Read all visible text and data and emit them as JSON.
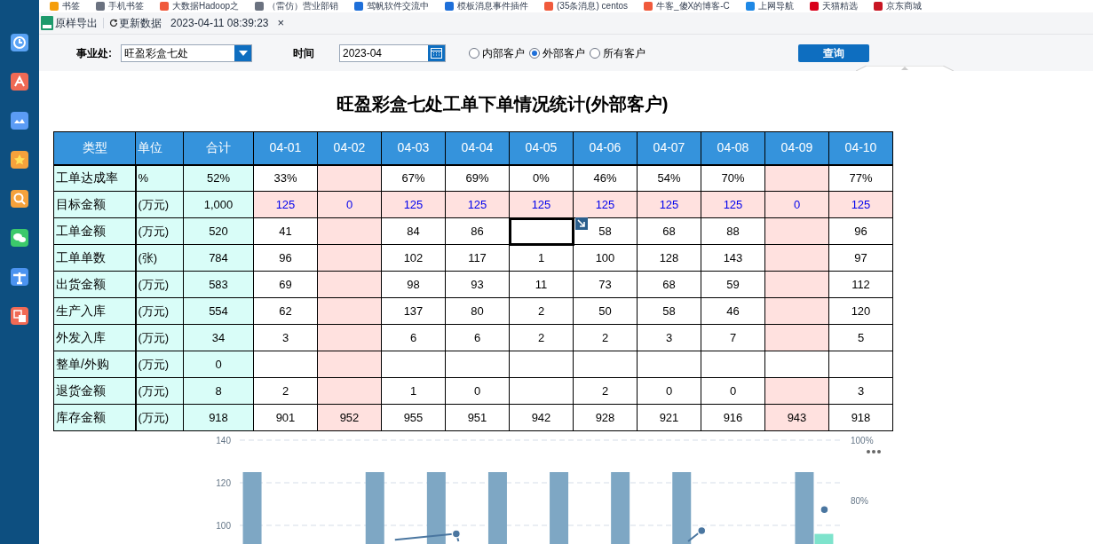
{
  "bookmarks": [
    {
      "label": "书签",
      "color": "#f59e0b"
    },
    {
      "label": "手机书签",
      "color": "#6b7280"
    },
    {
      "label": "大数据Hadoop之",
      "color": "#f05a3c"
    },
    {
      "label": "（雷仿）营业部销",
      "color": "#6b7280"
    },
    {
      "label": "驾帆软件交流中",
      "color": "#1e6fd9"
    },
    {
      "label": "模板消息事件插件",
      "color": "#1e6fd9"
    },
    {
      "label": "(35条消息) centos",
      "color": "#f05a3c"
    },
    {
      "label": "牛客_傻X的博客-C",
      "color": "#f05a3c"
    },
    {
      "label": "上网导航",
      "color": "#1e88e5"
    },
    {
      "label": "天猫精选",
      "color": "#d9001b"
    },
    {
      "label": "京东商城",
      "color": "#c81623"
    }
  ],
  "toolbar": {
    "export": "原样导出",
    "refresh": "更新数据",
    "timestamp": "2023-04-11 08:39:23",
    "close": "×"
  },
  "filters": {
    "division_label": "事业处:",
    "division_value": "旺盈彩盒七处",
    "time_label": "时间",
    "time_value": "2023-04",
    "customer_options": [
      {
        "label": "内部客户",
        "selected": false
      },
      {
        "label": "外部客户",
        "selected": true
      },
      {
        "label": "所有客户",
        "selected": false
      }
    ],
    "query_button": "查询"
  },
  "report": {
    "title": "旺盈彩盒七处工单下单情况统计(外部客户)",
    "columns": [
      "类型",
      "单位",
      "合计",
      "04-01",
      "04-02",
      "04-03",
      "04-04",
      "04-05",
      "04-06",
      "04-07",
      "04-08",
      "04-09",
      "04-10"
    ],
    "rows": [
      {
        "kind": "plain",
        "cells": [
          {
            "text": "工单达成率",
            "highlight": false,
            "selected": false
          },
          {
            "text": "%",
            "highlight": false,
            "selected": false
          },
          {
            "text": "52%",
            "highlight": false,
            "selected": false
          },
          {
            "text": "33%",
            "highlight": false,
            "selected": false
          },
          {
            "highlight": true,
            "selected": false
          },
          {
            "text": "67%",
            "highlight": false,
            "selected": false
          },
          {
            "text": "69%",
            "highlight": false,
            "selected": false
          },
          {
            "text": "0%",
            "highlight": false,
            "selected": false
          },
          {
            "text": "46%",
            "highlight": false,
            "selected": false
          },
          {
            "text": "54%",
            "highlight": false,
            "selected": false
          },
          {
            "text": "70%",
            "highlight": false,
            "selected": false
          },
          {
            "highlight": true,
            "selected": false
          },
          {
            "text": "77%",
            "highlight": false,
            "selected": false
          }
        ]
      },
      {
        "kind": "target",
        "cells": [
          {
            "text": "目标金额",
            "highlight": false,
            "selected": false
          },
          {
            "text": "(万元)",
            "highlight": false,
            "selected": false
          },
          {
            "text": "1,000",
            "highlight": false,
            "selected": false
          },
          {
            "text": "125",
            "highlight": true,
            "selected": false
          },
          {
            "text": "0",
            "highlight": true,
            "selected": false
          },
          {
            "text": "125",
            "highlight": true,
            "selected": false
          },
          {
            "text": "125",
            "highlight": true,
            "selected": false
          },
          {
            "text": "125",
            "highlight": true,
            "selected": false
          },
          {
            "text": "125",
            "highlight": true,
            "selected": false
          },
          {
            "text": "125",
            "highlight": true,
            "selected": false
          },
          {
            "text": "125",
            "highlight": true,
            "selected": false
          },
          {
            "text": "0",
            "highlight": true,
            "selected": false
          },
          {
            "text": "125",
            "highlight": true,
            "selected": false
          }
        ]
      },
      {
        "kind": "plain",
        "cells": [
          {
            "text": "工单金额",
            "highlight": false,
            "selected": false
          },
          {
            "text": "(万元)",
            "highlight": false,
            "selected": false
          },
          {
            "text": "520",
            "highlight": false,
            "selected": false
          },
          {
            "text": "41",
            "highlight": false,
            "selected": false
          },
          {
            "highlight": true,
            "selected": false
          },
          {
            "text": "84",
            "highlight": false,
            "selected": false
          },
          {
            "text": "86",
            "highlight": false,
            "selected": false
          },
          {
            "highlight": false,
            "selected": true
          },
          {
            "text": "58",
            "highlight": false,
            "selected": false
          },
          {
            "text": "68",
            "highlight": false,
            "selected": false
          },
          {
            "text": "88",
            "highlight": false,
            "selected": false
          },
          {
            "highlight": true,
            "selected": false
          },
          {
            "text": "96",
            "highlight": false,
            "selected": false
          }
        ]
      },
      {
        "kind": "plain",
        "cells": [
          {
            "text": "工单单数",
            "highlight": false,
            "selected": false
          },
          {
            "text": "(张)",
            "highlight": false,
            "selected": false
          },
          {
            "text": "784",
            "highlight": false,
            "selected": false
          },
          {
            "text": "96",
            "highlight": false,
            "selected": false
          },
          {
            "highlight": true,
            "selected": false
          },
          {
            "text": "102",
            "highlight": false,
            "selected": false
          },
          {
            "text": "117",
            "highlight": false,
            "selected": false
          },
          {
            "text": "1",
            "highlight": false,
            "selected": false
          },
          {
            "text": "100",
            "highlight": false,
            "selected": false
          },
          {
            "text": "128",
            "highlight": false,
            "selected": false
          },
          {
            "text": "143",
            "highlight": false,
            "selected": false
          },
          {
            "highlight": true,
            "selected": false
          },
          {
            "text": "97",
            "highlight": false,
            "selected": false
          }
        ]
      },
      {
        "kind": "plain",
        "cells": [
          {
            "text": "出货金额",
            "highlight": false,
            "selected": false
          },
          {
            "text": "(万元)",
            "highlight": false,
            "selected": false
          },
          {
            "text": "583",
            "highlight": false,
            "selected": false
          },
          {
            "text": "69",
            "highlight": false,
            "selected": false
          },
          {
            "highlight": true,
            "selected": false
          },
          {
            "text": "98",
            "highlight": false,
            "selected": false
          },
          {
            "text": "93",
            "highlight": false,
            "selected": false
          },
          {
            "text": "11",
            "highlight": false,
            "selected": false
          },
          {
            "text": "73",
            "highlight": false,
            "selected": false
          },
          {
            "text": "68",
            "highlight": false,
            "selected": false
          },
          {
            "text": "59",
            "highlight": false,
            "selected": false
          },
          {
            "highlight": true,
            "selected": false
          },
          {
            "text": "112",
            "highlight": false,
            "selected": false
          }
        ]
      },
      {
        "kind": "plain",
        "cells": [
          {
            "text": "生产入库",
            "highlight": false,
            "selected": false
          },
          {
            "text": "(万元)",
            "highlight": false,
            "selected": false
          },
          {
            "text": "554",
            "highlight": false,
            "selected": false
          },
          {
            "text": "62",
            "highlight": false,
            "selected": false
          },
          {
            "highlight": true,
            "selected": false
          },
          {
            "text": "137",
            "highlight": false,
            "selected": false
          },
          {
            "text": "80",
            "highlight": false,
            "selected": false
          },
          {
            "text": "2",
            "highlight": false,
            "selected": false
          },
          {
            "text": "50",
            "highlight": false,
            "selected": false
          },
          {
            "text": "58",
            "highlight": false,
            "selected": false
          },
          {
            "text": "46",
            "highlight": false,
            "selected": false
          },
          {
            "highlight": true,
            "selected": false
          },
          {
            "text": "120",
            "highlight": false,
            "selected": false
          }
        ]
      },
      {
        "kind": "plain",
        "cells": [
          {
            "text": "外发入库",
            "highlight": false,
            "selected": false
          },
          {
            "text": "(万元)",
            "highlight": false,
            "selected": false
          },
          {
            "text": "34",
            "highlight": false,
            "selected": false
          },
          {
            "text": "3",
            "highlight": false,
            "selected": false
          },
          {
            "highlight": true,
            "selected": false
          },
          {
            "text": "6",
            "highlight": false,
            "selected": false
          },
          {
            "text": "6",
            "highlight": false,
            "selected": false
          },
          {
            "text": "2",
            "highlight": false,
            "selected": false
          },
          {
            "text": "2",
            "highlight": false,
            "selected": false
          },
          {
            "text": "3",
            "highlight": false,
            "selected": false
          },
          {
            "text": "7",
            "highlight": false,
            "selected": false
          },
          {
            "highlight": true,
            "selected": false
          },
          {
            "text": "5",
            "highlight": false,
            "selected": false
          }
        ]
      },
      {
        "kind": "plain",
        "cells": [
          {
            "text": "整单/外购",
            "highlight": false,
            "selected": false
          },
          {
            "text": "(万元)",
            "highlight": false,
            "selected": false
          },
          {
            "text": "0",
            "highlight": false,
            "selected": false
          },
          {
            "highlight": false,
            "selected": false
          },
          {
            "highlight": true,
            "selected": false
          },
          {
            "highlight": false,
            "selected": false
          },
          {
            "highlight": false,
            "selected": false
          },
          {
            "highlight": false,
            "selected": false
          },
          {
            "highlight": false,
            "selected": false
          },
          {
            "highlight": false,
            "selected": false
          },
          {
            "highlight": false,
            "selected": false
          },
          {
            "highlight": false,
            "selected": false
          },
          {
            "highlight": false,
            "selected": false
          }
        ]
      },
      {
        "kind": "plain",
        "cells": [
          {
            "text": "退货金额",
            "highlight": false,
            "selected": false
          },
          {
            "text": "(万元)",
            "highlight": false,
            "selected": false
          },
          {
            "text": "8",
            "highlight": false,
            "selected": false
          },
          {
            "text": "2",
            "highlight": false,
            "selected": false
          },
          {
            "highlight": true,
            "selected": false
          },
          {
            "text": "1",
            "highlight": false,
            "selected": false
          },
          {
            "text": "0",
            "highlight": false,
            "selected": false
          },
          {
            "highlight": false,
            "selected": false
          },
          {
            "text": "2",
            "highlight": false,
            "selected": false
          },
          {
            "text": "0",
            "highlight": false,
            "selected": false
          },
          {
            "text": "0",
            "highlight": false,
            "selected": false
          },
          {
            "highlight": true,
            "selected": false
          },
          {
            "text": "3",
            "highlight": false,
            "selected": false
          }
        ]
      },
      {
        "kind": "plain",
        "cells": [
          {
            "text": "库存金额",
            "highlight": false,
            "selected": false
          },
          {
            "text": "(万元)",
            "highlight": false,
            "selected": false
          },
          {
            "text": "918",
            "highlight": false,
            "selected": false
          },
          {
            "text": "901",
            "highlight": false,
            "selected": false
          },
          {
            "text": "952",
            "highlight": true,
            "selected": false
          },
          {
            "text": "955",
            "highlight": false,
            "selected": false
          },
          {
            "text": "951",
            "highlight": false,
            "selected": false
          },
          {
            "text": "942",
            "highlight": false,
            "selected": false
          },
          {
            "text": "928",
            "highlight": false,
            "selected": false
          },
          {
            "text": "921",
            "highlight": false,
            "selected": false
          },
          {
            "text": "916",
            "highlight": false,
            "selected": false
          },
          {
            "text": "943",
            "highlight": true,
            "selected": false
          },
          {
            "text": "918",
            "highlight": false,
            "selected": false
          }
        ]
      }
    ],
    "chart": {
      "right_axis_labels": [
        "100%",
        "80%"
      ],
      "chart_data": {
        "type": "bar",
        "yticks": [
          100,
          120,
          140
        ],
        "ylim": [
          86,
          140
        ],
        "series": [
          {
            "color": "#7ea7c4",
            "values": [
              125,
              null,
              125,
              125,
              125,
              125,
              125,
              125,
              null,
              125
            ]
          },
          {
            "color": "#7ee3cc",
            "values": [
              null,
              null,
              null,
              null,
              null,
              null,
              null,
              null,
              null,
              96
            ]
          }
        ]
      }
    }
  }
}
